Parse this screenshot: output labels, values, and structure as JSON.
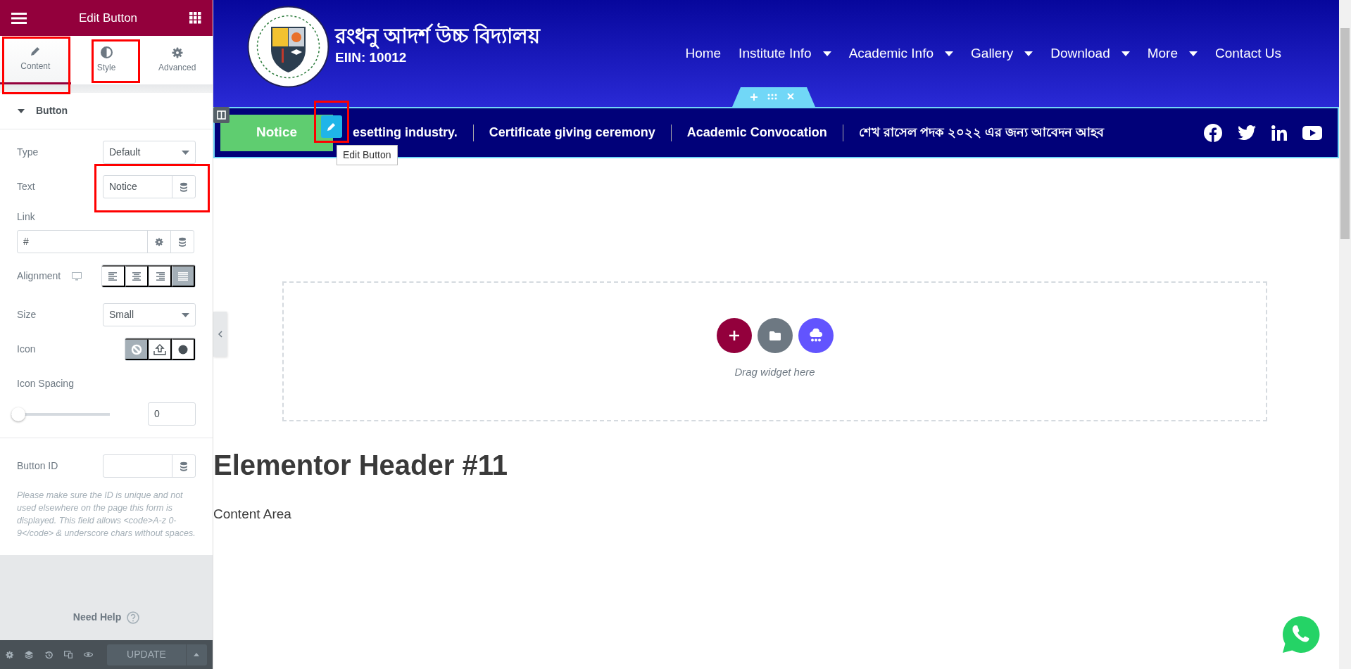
{
  "panel": {
    "title": "Edit Button",
    "tabs": [
      {
        "label": "Content",
        "selected": true,
        "highlighted": true
      },
      {
        "label": "Style",
        "selected": false,
        "highlighted": true
      },
      {
        "label": "Advanced",
        "selected": false,
        "highlighted": false
      }
    ],
    "section": {
      "title": "Button",
      "expanded": true
    },
    "controls": [
      {
        "kind": "select",
        "label": "Type",
        "value": "Default"
      },
      {
        "kind": "text",
        "label": "Text",
        "value": "Notice",
        "highlighted": true
      },
      {
        "kind": "url",
        "label": "Link",
        "value": "#"
      },
      {
        "kind": "choose",
        "label": "Alignment",
        "responsive": true,
        "options": [
          {
            "kind": "left",
            "selected": false
          },
          {
            "kind": "center",
            "selected": false
          },
          {
            "kind": "right",
            "selected": false
          },
          {
            "kind": "justify",
            "selected": true
          }
        ]
      },
      {
        "kind": "select",
        "label": "Size",
        "value": "Small"
      },
      {
        "kind": "choose",
        "label": "Icon",
        "responsive": false,
        "options": [
          {
            "kind": "none",
            "selected": true
          },
          {
            "kind": "upload",
            "selected": false
          },
          {
            "kind": "circle",
            "selected": false
          }
        ]
      },
      {
        "kind": "slider",
        "label": "Icon Spacing",
        "level": 0,
        "value": "0"
      }
    ],
    "id_control": {
      "label": "Button ID",
      "description": "Please make sure the ID is unique and not used elsewhere on the page this form is displayed. This field allows <code>A-z 0-9</code> & underscore chars without spaces."
    },
    "help": "Need Help",
    "update_button": "UPDATE"
  },
  "site": {
    "name": "রংধনু আদর্শ উচ্চ বিদ্যালয়",
    "eiin": "EIIN: 10012",
    "menu": [
      {
        "label": "Home",
        "dropdown": false
      },
      {
        "label": "Institute Info",
        "dropdown": true
      },
      {
        "label": "Academic Info",
        "dropdown": true
      },
      {
        "label": "Gallery",
        "dropdown": true
      },
      {
        "label": "Download",
        "dropdown": true
      },
      {
        "label": "More",
        "dropdown": true
      },
      {
        "label": "Contact Us",
        "dropdown": false
      }
    ]
  },
  "ticker": {
    "button": "Notice",
    "edit_highlighted": true,
    "tooltip": "Edit Button",
    "items": [
      "esetting industry.",
      "Certificate giving ceremony",
      "Academic Convocation",
      "শেখ রাসেল পদক ২০২২ এর জন্য আবেদন আহব"
    ]
  },
  "drop_zone": {
    "hint": "Drag widget here"
  },
  "content": {
    "heading": "Elementor Header #11",
    "text": "Content Area"
  }
}
